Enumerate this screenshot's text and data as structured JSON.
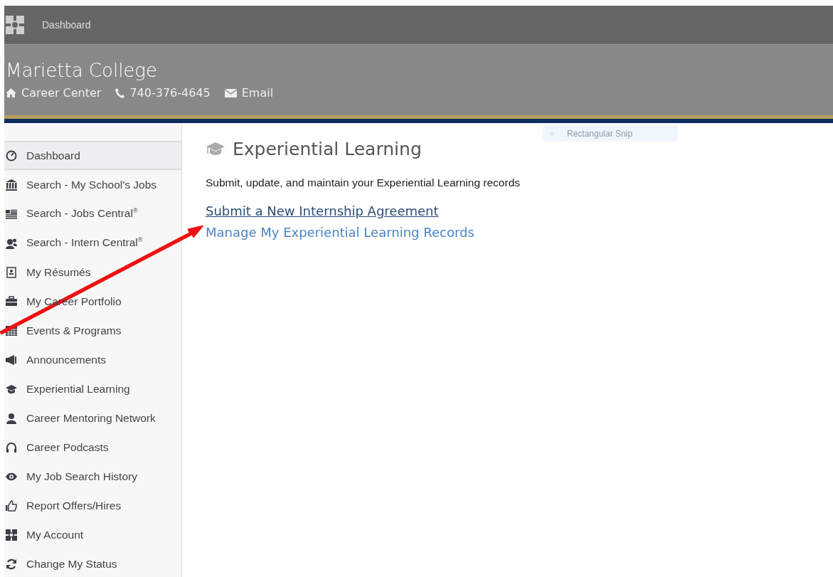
{
  "top_bar": {
    "title": "Dashboard"
  },
  "header": {
    "school": "Marietta College",
    "contacts": [
      {
        "kind": "home",
        "text": "Career Center"
      },
      {
        "kind": "phone",
        "text": "740-376-4645"
      },
      {
        "kind": "mail",
        "text": "Email"
      }
    ]
  },
  "sidebar": {
    "items": [
      {
        "label": "Dashboard",
        "selected": true
      },
      {
        "label": "Search - My School's Jobs",
        "selected": false
      },
      {
        "label": "Search - Jobs Central$^{®}$",
        "selected": false
      },
      {
        "label": "Search - Intern Central$^{®}$",
        "selected": false
      },
      {
        "label": "My Résumés",
        "selected": false
      },
      {
        "label": "My Career Portfolio",
        "selected": false
      },
      {
        "label": "Events & Programs",
        "selected": false
      },
      {
        "label": "Announcements",
        "selected": false
      },
      {
        "label": "Experiential Learning",
        "selected": false
      },
      {
        "label": "Career Mentoring Network",
        "selected": false
      },
      {
        "label": "Career Podcasts",
        "selected": false
      },
      {
        "label": "My Job Search History",
        "selected": false
      },
      {
        "label": "Report Offers/Hires",
        "selected": false
      },
      {
        "label": "My Account",
        "selected": false
      },
      {
        "label": "Change My Status",
        "selected": false
      }
    ]
  },
  "content": {
    "heading": "Experiential Learning",
    "description": "Submit, update, and maintain your Experiential Learning records",
    "links": [
      {
        "label": "Submit a New Internship Agreement",
        "hovered": true
      },
      {
        "label": "Manage My Experiential Learning Records",
        "hovered": false
      }
    ]
  },
  "snip_tooltip": {
    "label": "Rectangular Snip"
  }
}
